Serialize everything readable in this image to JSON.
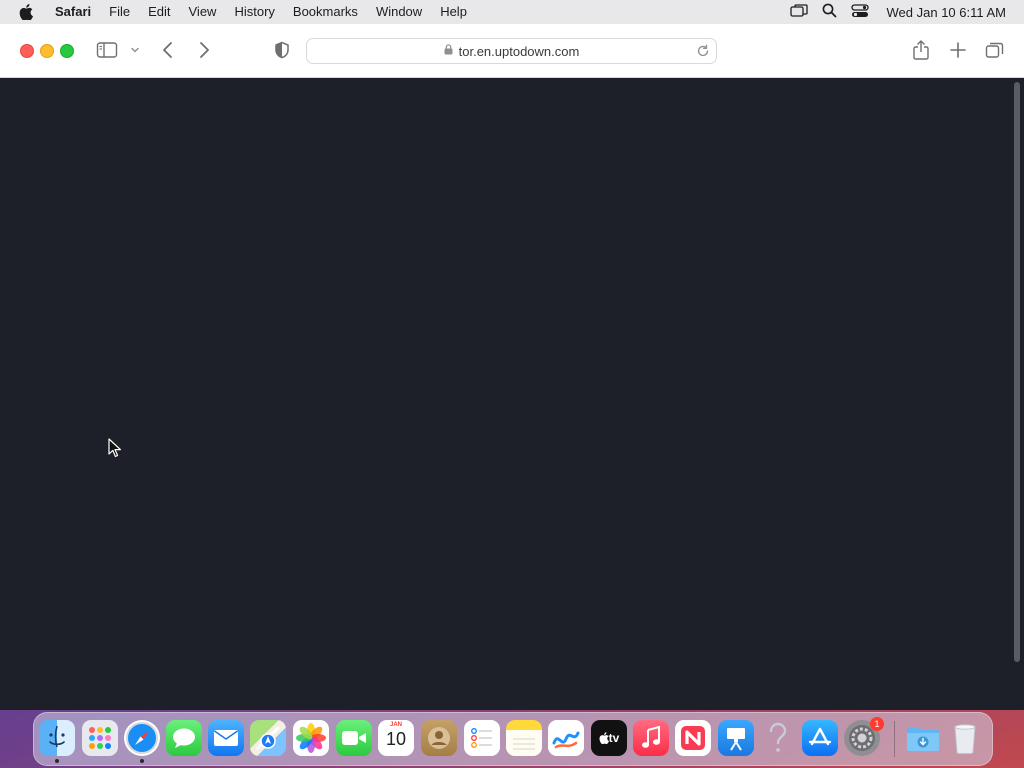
{
  "menubar": {
    "app_name": "Safari",
    "items": [
      "File",
      "Edit",
      "View",
      "History",
      "Bookmarks",
      "Window",
      "Help"
    ],
    "clock": "Wed Jan 10  6:11 AM"
  },
  "browser": {
    "url": "tor.en.uptodown.com"
  },
  "dock": {
    "apps": [
      {
        "name": "Finder",
        "icon": "finder-icon",
        "running": true
      },
      {
        "name": "Launchpad",
        "icon": "launchpad-icon",
        "running": false
      },
      {
        "name": "Safari",
        "icon": "safari-icon",
        "running": true
      },
      {
        "name": "Messages",
        "icon": "messages-icon",
        "running": false
      },
      {
        "name": "Mail",
        "icon": "mail-icon",
        "running": false
      },
      {
        "name": "Maps",
        "icon": "maps-icon",
        "running": false
      },
      {
        "name": "Photos",
        "icon": "photos-icon",
        "running": false
      },
      {
        "name": "FaceTime",
        "icon": "facetime-icon",
        "running": false
      },
      {
        "name": "Calendar",
        "icon": "calendar-icon",
        "running": false
      },
      {
        "name": "Contacts",
        "icon": "contacts-icon",
        "running": false
      },
      {
        "name": "Reminders",
        "icon": "reminders-icon",
        "running": false
      },
      {
        "name": "Notes",
        "icon": "notes-icon",
        "running": false
      },
      {
        "name": "Freeform",
        "icon": "freeform-icon",
        "running": false
      },
      {
        "name": "TV",
        "icon": "tv-icon",
        "running": false
      },
      {
        "name": "Music",
        "icon": "music-icon",
        "running": false
      },
      {
        "name": "News",
        "icon": "news-icon",
        "running": false
      },
      {
        "name": "Keynote",
        "icon": "keynote-icon",
        "running": false
      },
      {
        "name": "Unknown App",
        "icon": "question-mark-icon",
        "running": false
      },
      {
        "name": "App Store",
        "icon": "app-store-icon",
        "running": false
      },
      {
        "name": "System Settings",
        "icon": "system-settings-icon",
        "running": false
      },
      {
        "name": "Downloads",
        "icon": "downloads-folder-icon",
        "running": false
      },
      {
        "name": "Trash",
        "icon": "trash-icon",
        "running": false
      }
    ],
    "calendar": {
      "month": "JAN",
      "day": "10"
    },
    "tv_label": "tv",
    "settings_badge": "1"
  },
  "colors": {
    "page_background": "#1e2029",
    "close": "#fe5f57",
    "minimize": "#febc2e",
    "maximize": "#28c840"
  }
}
